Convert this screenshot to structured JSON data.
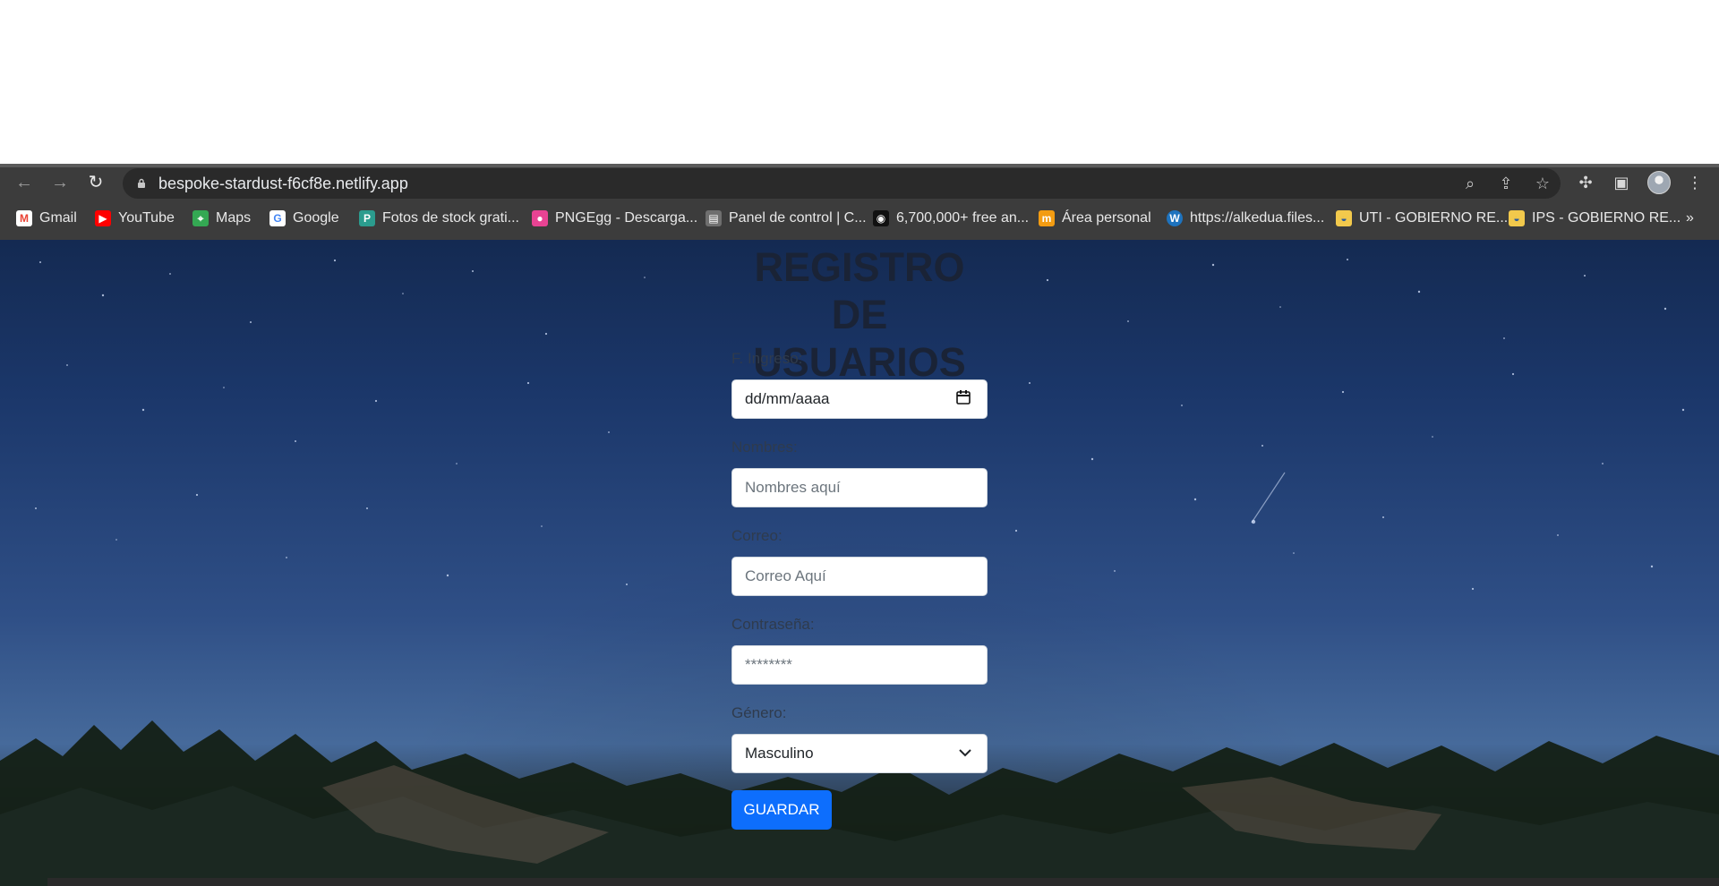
{
  "browser": {
    "url": "bespoke-stardust-f6cf8e.netlify.app",
    "bookmarks": [
      {
        "label": "Gmail",
        "icon": "gmail-icon",
        "color": "#ea4335"
      },
      {
        "label": "YouTube",
        "icon": "youtube-icon",
        "color": "#ff0000"
      },
      {
        "label": "Maps",
        "icon": "maps-icon",
        "color": "#34a853"
      },
      {
        "label": "Google",
        "icon": "google-icon",
        "color": "#4285f4"
      },
      {
        "label": "Fotos de stock grati...",
        "icon": "stock-photos-icon",
        "color": "#2b9c8e"
      },
      {
        "label": "PNGEgg - Descarga...",
        "icon": "pngegg-icon",
        "color": "#e84393"
      },
      {
        "label": "Panel de control | C...",
        "icon": "control-panel-icon",
        "color": "#6f6f6f"
      },
      {
        "label": "6,700,000+ free an...",
        "icon": "free-images-icon",
        "color": "#111111"
      },
      {
        "label": "Área personal",
        "icon": "personal-area-icon",
        "color": "#f39c12"
      },
      {
        "label": "https://alkedua.files...",
        "icon": "wordpress-icon",
        "color": "#1e73be"
      },
      {
        "label": "UTI - GOBIERNO RE...",
        "icon": "government-icon",
        "color": "#f2c94c"
      },
      {
        "label": "IPS - GOBIERNO RE...",
        "icon": "government-icon-2",
        "color": "#f2c94c"
      }
    ],
    "overflow_label": "»"
  },
  "form": {
    "title_line1": "REGISTRO",
    "title_line2": "DE USUARIOS",
    "entry_date_label": "F. Ingreso:",
    "entry_date_placeholder": "dd/mm/aaaa",
    "name_label": "Nombres:",
    "name_placeholder": "Nombres aquí",
    "email_label": "Correo:",
    "email_placeholder": "Correo Aquí",
    "password_label": "Contraseña:",
    "password_placeholder": "********",
    "gender_label": "Género:",
    "gender_value": "Masculino",
    "save_label": "GUARDAR"
  },
  "colors": {
    "sky_top": "#142a52",
    "sky_mid": "#2f4f86",
    "button": "#0d6efd",
    "browser_toolbar": "#3c3c3c"
  }
}
